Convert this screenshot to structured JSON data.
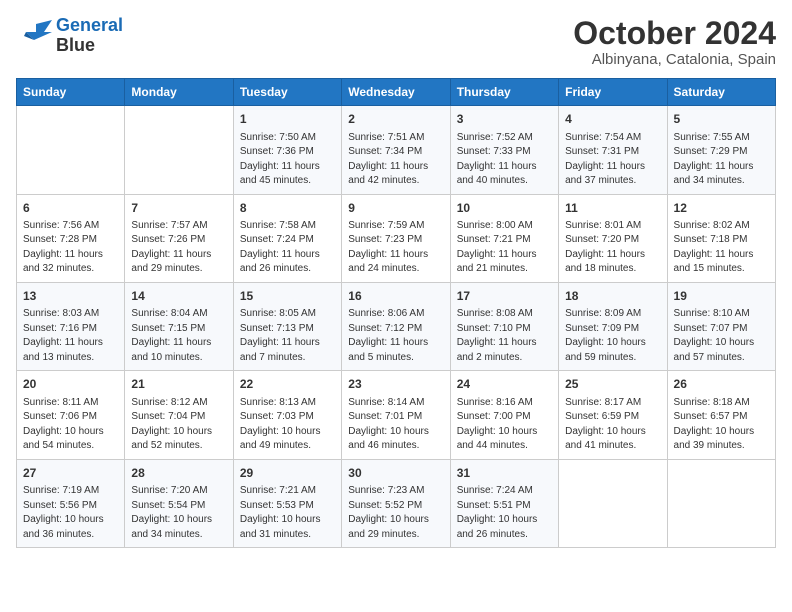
{
  "header": {
    "logo_line1": "General",
    "logo_line2": "Blue",
    "title": "October 2024",
    "subtitle": "Albinyana, Catalonia, Spain"
  },
  "columns": [
    "Sunday",
    "Monday",
    "Tuesday",
    "Wednesday",
    "Thursday",
    "Friday",
    "Saturday"
  ],
  "weeks": [
    [
      {
        "day": "",
        "info": ""
      },
      {
        "day": "",
        "info": ""
      },
      {
        "day": "1",
        "info": "Sunrise: 7:50 AM\nSunset: 7:36 PM\nDaylight: 11 hours and 45 minutes."
      },
      {
        "day": "2",
        "info": "Sunrise: 7:51 AM\nSunset: 7:34 PM\nDaylight: 11 hours and 42 minutes."
      },
      {
        "day": "3",
        "info": "Sunrise: 7:52 AM\nSunset: 7:33 PM\nDaylight: 11 hours and 40 minutes."
      },
      {
        "day": "4",
        "info": "Sunrise: 7:54 AM\nSunset: 7:31 PM\nDaylight: 11 hours and 37 minutes."
      },
      {
        "day": "5",
        "info": "Sunrise: 7:55 AM\nSunset: 7:29 PM\nDaylight: 11 hours and 34 minutes."
      }
    ],
    [
      {
        "day": "6",
        "info": "Sunrise: 7:56 AM\nSunset: 7:28 PM\nDaylight: 11 hours and 32 minutes."
      },
      {
        "day": "7",
        "info": "Sunrise: 7:57 AM\nSunset: 7:26 PM\nDaylight: 11 hours and 29 minutes."
      },
      {
        "day": "8",
        "info": "Sunrise: 7:58 AM\nSunset: 7:24 PM\nDaylight: 11 hours and 26 minutes."
      },
      {
        "day": "9",
        "info": "Sunrise: 7:59 AM\nSunset: 7:23 PM\nDaylight: 11 hours and 24 minutes."
      },
      {
        "day": "10",
        "info": "Sunrise: 8:00 AM\nSunset: 7:21 PM\nDaylight: 11 hours and 21 minutes."
      },
      {
        "day": "11",
        "info": "Sunrise: 8:01 AM\nSunset: 7:20 PM\nDaylight: 11 hours and 18 minutes."
      },
      {
        "day": "12",
        "info": "Sunrise: 8:02 AM\nSunset: 7:18 PM\nDaylight: 11 hours and 15 minutes."
      }
    ],
    [
      {
        "day": "13",
        "info": "Sunrise: 8:03 AM\nSunset: 7:16 PM\nDaylight: 11 hours and 13 minutes."
      },
      {
        "day": "14",
        "info": "Sunrise: 8:04 AM\nSunset: 7:15 PM\nDaylight: 11 hours and 10 minutes."
      },
      {
        "day": "15",
        "info": "Sunrise: 8:05 AM\nSunset: 7:13 PM\nDaylight: 11 hours and 7 minutes."
      },
      {
        "day": "16",
        "info": "Sunrise: 8:06 AM\nSunset: 7:12 PM\nDaylight: 11 hours and 5 minutes."
      },
      {
        "day": "17",
        "info": "Sunrise: 8:08 AM\nSunset: 7:10 PM\nDaylight: 11 hours and 2 minutes."
      },
      {
        "day": "18",
        "info": "Sunrise: 8:09 AM\nSunset: 7:09 PM\nDaylight: 10 hours and 59 minutes."
      },
      {
        "day": "19",
        "info": "Sunrise: 8:10 AM\nSunset: 7:07 PM\nDaylight: 10 hours and 57 minutes."
      }
    ],
    [
      {
        "day": "20",
        "info": "Sunrise: 8:11 AM\nSunset: 7:06 PM\nDaylight: 10 hours and 54 minutes."
      },
      {
        "day": "21",
        "info": "Sunrise: 8:12 AM\nSunset: 7:04 PM\nDaylight: 10 hours and 52 minutes."
      },
      {
        "day": "22",
        "info": "Sunrise: 8:13 AM\nSunset: 7:03 PM\nDaylight: 10 hours and 49 minutes."
      },
      {
        "day": "23",
        "info": "Sunrise: 8:14 AM\nSunset: 7:01 PM\nDaylight: 10 hours and 46 minutes."
      },
      {
        "day": "24",
        "info": "Sunrise: 8:16 AM\nSunset: 7:00 PM\nDaylight: 10 hours and 44 minutes."
      },
      {
        "day": "25",
        "info": "Sunrise: 8:17 AM\nSunset: 6:59 PM\nDaylight: 10 hours and 41 minutes."
      },
      {
        "day": "26",
        "info": "Sunrise: 8:18 AM\nSunset: 6:57 PM\nDaylight: 10 hours and 39 minutes."
      }
    ],
    [
      {
        "day": "27",
        "info": "Sunrise: 7:19 AM\nSunset: 5:56 PM\nDaylight: 10 hours and 36 minutes."
      },
      {
        "day": "28",
        "info": "Sunrise: 7:20 AM\nSunset: 5:54 PM\nDaylight: 10 hours and 34 minutes."
      },
      {
        "day": "29",
        "info": "Sunrise: 7:21 AM\nSunset: 5:53 PM\nDaylight: 10 hours and 31 minutes."
      },
      {
        "day": "30",
        "info": "Sunrise: 7:23 AM\nSunset: 5:52 PM\nDaylight: 10 hours and 29 minutes."
      },
      {
        "day": "31",
        "info": "Sunrise: 7:24 AM\nSunset: 5:51 PM\nDaylight: 10 hours and 26 minutes."
      },
      {
        "day": "",
        "info": ""
      },
      {
        "day": "",
        "info": ""
      }
    ]
  ]
}
